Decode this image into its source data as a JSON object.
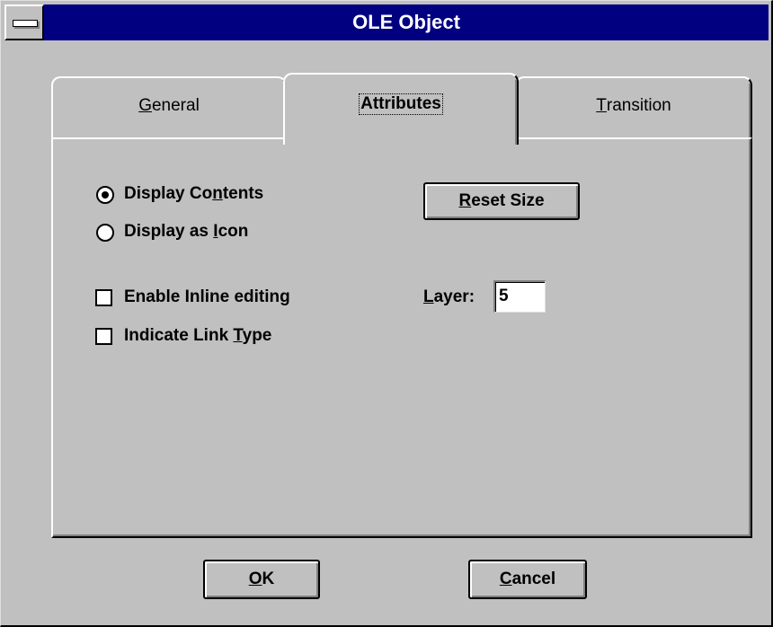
{
  "window": {
    "title": "OLE Object",
    "system_menu_icon": "system-menu-icon"
  },
  "tabs": [
    {
      "label_pre": "",
      "label_mnemonic": "G",
      "label_post": "eneral",
      "selected": false
    },
    {
      "label_pre": "",
      "label_mnemonic": "",
      "label_post": "Attributes",
      "selected": true
    },
    {
      "label_pre": "",
      "label_mnemonic": "T",
      "label_post": "ransition",
      "selected": false
    }
  ],
  "attributes": {
    "display_contents": {
      "pre": "Display Co",
      "mnemonic": "n",
      "post": "tents",
      "selected": true
    },
    "display_as_icon": {
      "pre": "Display as ",
      "mnemonic": "I",
      "post": "con",
      "selected": false
    },
    "enable_inline_editing": {
      "label": "Enable Inline editing",
      "checked": false
    },
    "indicate_link_type": {
      "pre": "Indicate Link ",
      "mnemonic": "T",
      "post": "ype",
      "checked": false
    },
    "reset_size": {
      "pre": "",
      "mnemonic": "R",
      "post": "eset Size"
    },
    "layer": {
      "pre": "",
      "mnemonic": "L",
      "post": "ayer:",
      "value": "5"
    }
  },
  "buttons": {
    "ok": {
      "pre": "",
      "mnemonic": "O",
      "post": "K"
    },
    "cancel": {
      "pre": "",
      "mnemonic": "C",
      "post": "ancel"
    }
  }
}
